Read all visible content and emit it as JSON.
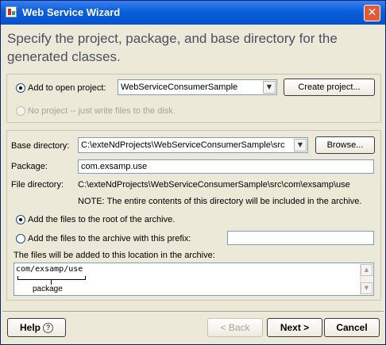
{
  "window": {
    "title": "Web Service Wizard"
  },
  "heading": "Specify the project, package, and base directory for the generated classes.",
  "project": {
    "add_open_label": "Add to open project:",
    "selected_project": "WebServiceConsumerSample",
    "create_project_label": "Create project...",
    "no_project_label": "No project -- just write files to the disk."
  },
  "settings": {
    "base_dir_label": "Base directory:",
    "base_dir_value": "C:\\exteNdProjects\\WebServiceConsumerSample\\src",
    "browse_label": "Browse...",
    "package_label": "Package:",
    "package_value": "com.exsamp.use",
    "file_dir_label": "File directory:",
    "file_dir_value": "C:\\exteNdProjects\\WebServiceConsumerSample\\src\\com\\exsamp\\use",
    "note": "NOTE: The entire contents of this directory will be included in the archive.",
    "root_option_label": "Add the files to the root of the archive.",
    "prefix_option_label": "Add the files to the archive with this prefix:",
    "prefix_value": "",
    "location_label": "The files will be added to this location in the archive:",
    "archive_path": "com/exsamp/use",
    "package_caption": "package"
  },
  "footer": {
    "help_label": "Help",
    "help_icon": "?",
    "back_label": "< Back",
    "next_label": "Next >",
    "cancel_label": "Cancel"
  }
}
